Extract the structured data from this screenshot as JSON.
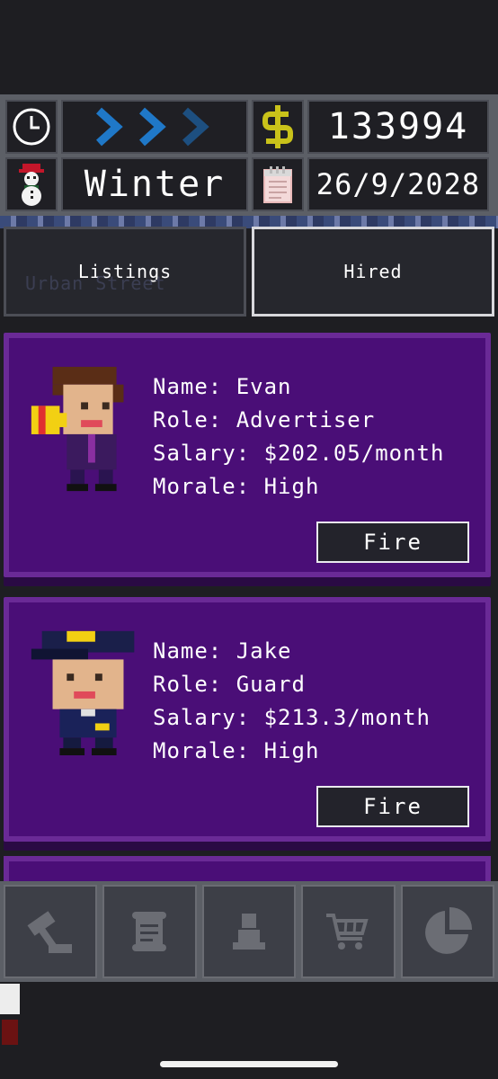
{
  "hud": {
    "money": "133994",
    "season": "Winter",
    "date": "26/9/2028",
    "speed_arrows": 3,
    "icons": {
      "clock": "clock-icon",
      "speed": "fast-forward-icon",
      "money": "dollar-icon",
      "season": "snowman-icon",
      "calendar": "calendar-icon"
    },
    "colors": {
      "arrow": "#1f78c8",
      "dollar": "#c9c21a"
    }
  },
  "tabs": [
    {
      "label": "Listings",
      "active": false
    },
    {
      "label": "Hired",
      "active": true
    }
  ],
  "background_text": "Urban Street",
  "employees": [
    {
      "name_label": "Name: Evan",
      "role_label": "Role: Advertiser",
      "salary_label": "Salary: $202.05/month",
      "morale_label": "Morale: High",
      "fire_label": "Fire",
      "avatar": "advertiser-avatar"
    },
    {
      "name_label": "Name: Jake",
      "role_label": "Role: Guard",
      "salary_label": "Salary: $213.3/month",
      "morale_label": "Morale: High",
      "fire_label": "Fire",
      "avatar": "guard-avatar"
    }
  ],
  "bottom_nav": [
    {
      "icon": "build-hammer-icon"
    },
    {
      "icon": "scroll-icon"
    },
    {
      "icon": "staff-person-icon"
    },
    {
      "icon": "cart-icon"
    },
    {
      "icon": "pie-chart-icon"
    }
  ]
}
